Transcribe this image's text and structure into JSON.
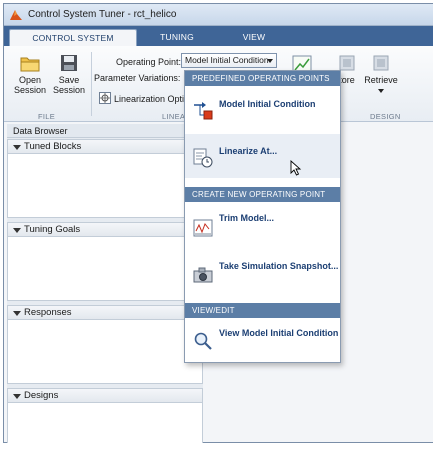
{
  "window": {
    "title": "Control System Tuner - rct_helico"
  },
  "tabs": [
    {
      "label": "CONTROL SYSTEM",
      "active": true
    },
    {
      "label": "TUNING",
      "active": false
    },
    {
      "label": "VIEW",
      "active": false
    }
  ],
  "ribbon": {
    "open_session": "Open\nSession",
    "open_line1": "Open",
    "open_line2": "Session",
    "save_line1": "Save",
    "save_line2": "Session",
    "file_section": "FILE",
    "operating_point_label": "Operating Point:",
    "operating_point_value": "Model Initial Condition",
    "parameter_variations_label": "Parameter Variations:",
    "linearization_options": "Linearization Opti",
    "linear_section": "LINEA",
    "store_label": "tore",
    "retrieve_label": "Retrieve",
    "design_section": "DESIGN"
  },
  "data_browser": {
    "title": "Data Browser",
    "panes": [
      {
        "label": "Tuned Blocks"
      },
      {
        "label": "Tuning Goals"
      },
      {
        "label": "Responses"
      },
      {
        "label": "Designs"
      }
    ]
  },
  "menu": {
    "sections": [
      {
        "header": "PREDEFINED OPERATING POINTS"
      },
      {
        "header": "CREATE NEW OPERATING POINT"
      },
      {
        "header": "VIEW/EDIT"
      }
    ],
    "items": {
      "model_initial_condition": "Model Initial Condition",
      "linearize_at": "Linearize At...",
      "trim_model": "Trim Model...",
      "take_snapshot": "Take Simulation Snapshot...",
      "view_initial_condition": "View Model Initial Condition"
    }
  },
  "colors": {
    "tab_strip": "#3f6597",
    "menu_header": "#5c7ea6",
    "menu_text": "#1c3f73"
  }
}
